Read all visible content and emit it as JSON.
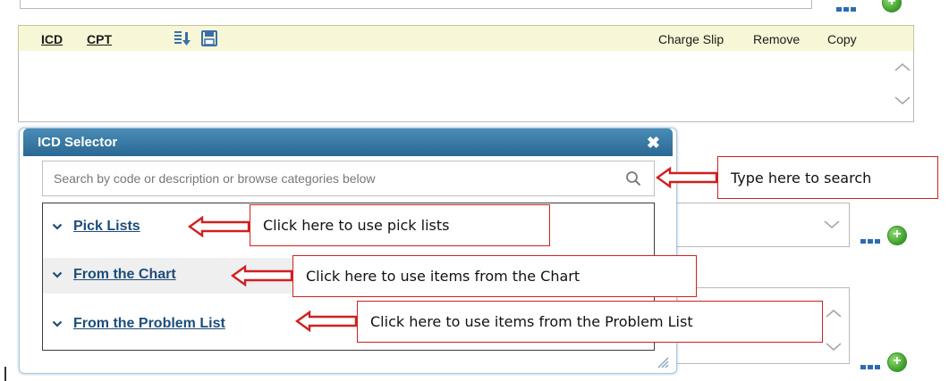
{
  "toolbar": {
    "icd_label": "ICD",
    "cpt_label": "CPT",
    "charge_slip_label": "Charge Slip",
    "remove_label": "Remove",
    "copy_label": "Copy",
    "icons": [
      "export-list-icon",
      "save-icon"
    ]
  },
  "selector": {
    "title": "ICD Selector",
    "close_label": "✖",
    "search_placeholder": "Search by code or description or browse categories below",
    "items": [
      {
        "label": "Pick Lists"
      },
      {
        "label": "From the Chart"
      },
      {
        "label": "From the Problem List"
      }
    ]
  },
  "callouts": {
    "search": "Type here to search",
    "pick_lists": "Click here to use pick lists",
    "chart": "Click here to use items from the Chart",
    "problem_list": "Click here to use items from the Problem List"
  },
  "colors": {
    "header_blue": "#2a6892",
    "toolbar_bg": "#f7f6d6",
    "link_blue": "#1d4d7a",
    "callout_red": "#d02020",
    "add_green": "#3b9c2a"
  }
}
